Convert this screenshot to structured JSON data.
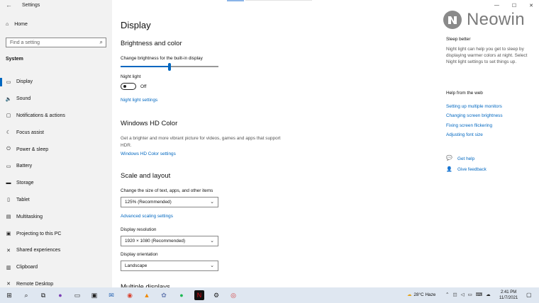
{
  "window": {
    "app_title": "Settings",
    "controls": [
      "—",
      "☐",
      "✕"
    ]
  },
  "sidebar": {
    "home_label": "Home",
    "search_placeholder": "Find a setting",
    "section_label": "System",
    "items": [
      {
        "label": "Display",
        "icon": "display-icon",
        "glyph": "▭",
        "active": true
      },
      {
        "label": "Sound",
        "icon": "sound-icon",
        "glyph": "🔈",
        "active": false
      },
      {
        "label": "Notifications & actions",
        "icon": "notifications-icon",
        "glyph": "▢",
        "active": false
      },
      {
        "label": "Focus assist",
        "icon": "focus-assist-icon",
        "glyph": "☾",
        "active": false
      },
      {
        "label": "Power & sleep",
        "icon": "power-icon",
        "glyph": "⏻",
        "active": false
      },
      {
        "label": "Battery",
        "icon": "battery-icon",
        "glyph": "▭",
        "active": false
      },
      {
        "label": "Storage",
        "icon": "storage-icon",
        "glyph": "▬",
        "active": false
      },
      {
        "label": "Tablet",
        "icon": "tablet-icon",
        "glyph": "▯",
        "active": false
      },
      {
        "label": "Multitasking",
        "icon": "multitasking-icon",
        "glyph": "▤",
        "active": false
      },
      {
        "label": "Projecting to this PC",
        "icon": "projecting-icon",
        "glyph": "▣",
        "active": false
      },
      {
        "label": "Shared experiences",
        "icon": "shared-experiences-icon",
        "glyph": "✕",
        "active": false
      },
      {
        "label": "Clipboard",
        "icon": "clipboard-icon",
        "glyph": "▥",
        "active": false
      },
      {
        "label": "Remote Desktop",
        "icon": "remote-desktop-icon",
        "glyph": "✕",
        "active": false
      }
    ]
  },
  "main": {
    "title": "Display",
    "brightness": {
      "heading": "Brightness and color",
      "label": "Change brightness for the built-in display",
      "level": 0.5
    },
    "night_light": {
      "label": "Night light",
      "state": "Off",
      "settings_link": "Night light settings"
    },
    "hd_color": {
      "heading": "Windows HD Color",
      "description": "Get a brighter and more vibrant picture for videos, games and apps that support HDR.",
      "link": "Windows HD Color settings"
    },
    "scale_layout": {
      "heading": "Scale and layout",
      "scale_label": "Change the size of text, apps, and other items",
      "scale_value": "125% (Recommended)",
      "advanced_link": "Advanced scaling settings",
      "resolution_label": "Display resolution",
      "resolution_value": "1920 × 1080 (Recommended)",
      "orientation_label": "Display orientation",
      "orientation_value": "Landscape"
    },
    "next_heading": "Multiple displays"
  },
  "right": {
    "logo_text": "Neowin",
    "sleep_heading": "Sleep better",
    "sleep_text": "Night light can help you get to sleep by displaying warmer colors at night. Select Night light settings to set things up.",
    "help_heading": "Help from the web",
    "help_links": [
      "Setting up multiple monitors",
      "Changing screen brightness",
      "Fixing screen flickering",
      "Adjusting font size"
    ],
    "get_help": "Get help",
    "give_feedback": "Give feedback"
  },
  "taskbar": {
    "weather": "28°C  Haze",
    "time": "2:41 PM",
    "date": "11/7/2021",
    "apps": [
      {
        "name": "start-icon",
        "glyph": "⊞",
        "color": "#1a1a1a",
        "bg": "transparent"
      },
      {
        "name": "search-icon",
        "glyph": "⌕",
        "color": "#1a1a1a",
        "bg": "transparent"
      },
      {
        "name": "task-view-icon",
        "glyph": "⧉",
        "color": "#1a1a1a",
        "bg": "transparent"
      },
      {
        "name": "app-purple-icon",
        "glyph": "●",
        "color": "#7b3fb5",
        "bg": "transparent"
      },
      {
        "name": "app-tray-icon",
        "glyph": "▭",
        "color": "#333",
        "bg": "transparent"
      },
      {
        "name": "store-icon",
        "glyph": "▣",
        "color": "#222",
        "bg": "transparent"
      },
      {
        "name": "mail-icon",
        "glyph": "✉",
        "color": "#1f5fb0",
        "bg": "transparent"
      },
      {
        "name": "chrome-icon",
        "glyph": "◉",
        "color": "#d9412f",
        "bg": "transparent"
      },
      {
        "name": "vlc-icon",
        "glyph": "▲",
        "color": "#f08a00",
        "bg": "transparent"
      },
      {
        "name": "app-misc-icon",
        "glyph": "✿",
        "color": "#6b7fb3",
        "bg": "transparent"
      },
      {
        "name": "spotify-icon",
        "glyph": "●",
        "color": "#1db954",
        "bg": "transparent"
      },
      {
        "name": "netflix-icon",
        "glyph": "N",
        "color": "#e50914",
        "bg": "#111"
      },
      {
        "name": "settings-gear-icon",
        "glyph": "⚙",
        "color": "#222",
        "bg": "transparent"
      },
      {
        "name": "app-red-icon",
        "glyph": "◎",
        "color": "#d23b3b",
        "bg": "transparent"
      }
    ]
  }
}
